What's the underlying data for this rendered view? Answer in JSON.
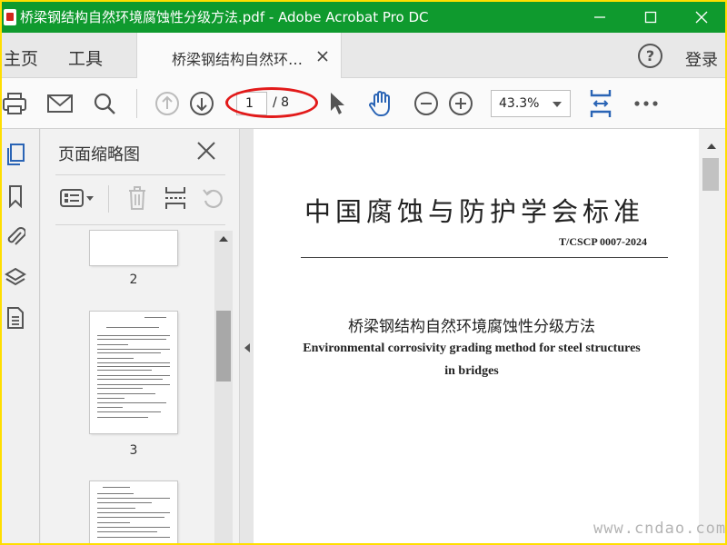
{
  "window": {
    "title": "桥梁钢结构自然环境腐蚀性分级方法.pdf - Adobe Acrobat Pro DC"
  },
  "tabbar": {
    "home_label": "主页",
    "tools_label": "工具",
    "doc_tab_label": "桥梁钢结构自然环…",
    "help_icon": "?",
    "login_label": "登录"
  },
  "toolbar": {
    "current_page": "1",
    "page_total": "/ 8",
    "zoom": "43.3%",
    "icons": [
      "print-icon",
      "email-icon",
      "search-icon",
      "page-up-icon",
      "page-down-icon",
      "select-cursor-icon",
      "hand-icon",
      "zoom-out-icon",
      "zoom-in-icon",
      "fit-page-icon",
      "more-icon"
    ],
    "accent_color": "#2a64b5",
    "highlight_color": "#e21a1a"
  },
  "sidebar": {
    "panel_title": "页面缩略图",
    "thumbnails": [
      {
        "page": "2"
      },
      {
        "page": "3"
      }
    ]
  },
  "document": {
    "standard_title": "中国腐蚀与防护学会标准",
    "standard_code": "T/CSCP 0007-2024",
    "title_cn": "桥梁钢结构自然环境腐蚀性分级方法",
    "title_en_line1": "Environmental corrosivity grading method for steel structures",
    "title_en_line2": "in bridges"
  },
  "watermark": "www.cndao.com",
  "colors": {
    "titlebar": "#0f9a2e",
    "frame": "#ffde00"
  }
}
